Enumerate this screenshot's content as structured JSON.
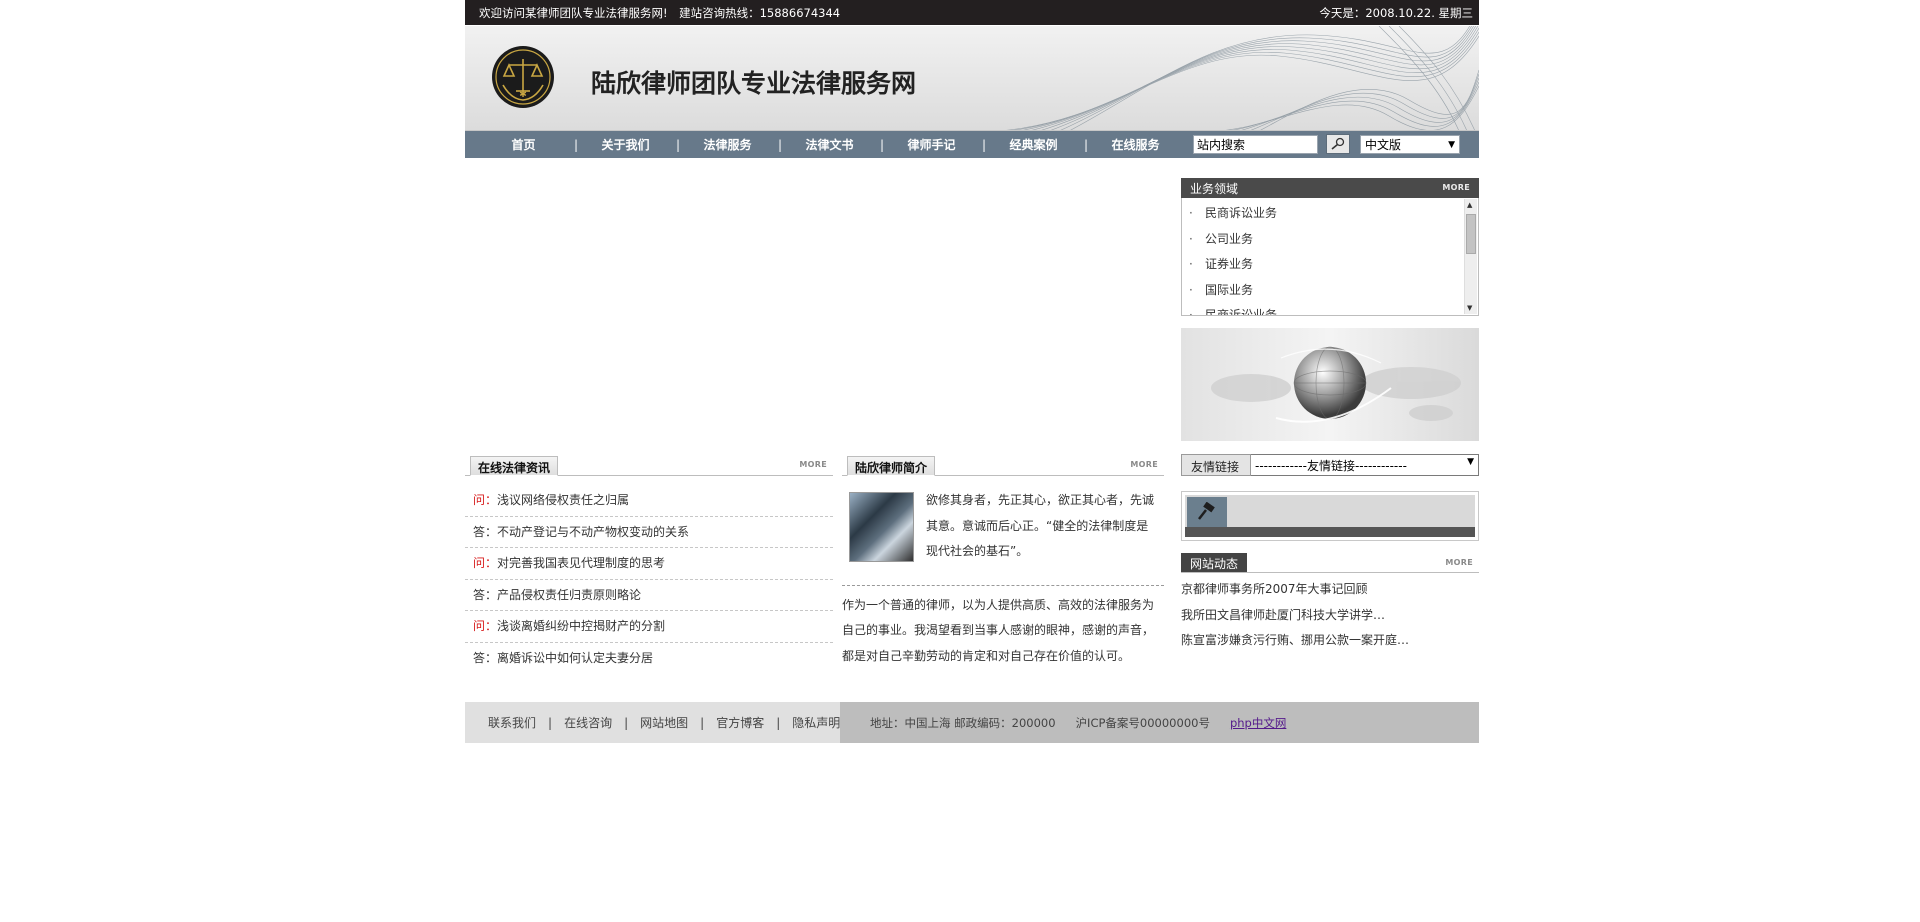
{
  "topbar": {
    "welcome": "欢迎访问某律师团队专业法律服务网!　建站咨询热线：15886674344",
    "date": "今天是：2008.10.22. 星期三"
  },
  "banner": {
    "title": "陆欣律师团队专业法律服务网"
  },
  "nav": {
    "items": [
      "首页",
      "关于我们",
      "法律服务",
      "法律文书",
      "律师手记",
      "经典案例",
      "在线服务"
    ],
    "separator": "|",
    "search_value": "站内搜索",
    "language": "中文版",
    "dropdown_arrow": "▼"
  },
  "more_label": "MORE",
  "news": {
    "title": "在线法律资讯",
    "items": [
      {
        "prefix": "问：",
        "text": "浅议网络侵权责任之归属"
      },
      {
        "prefix": "答：",
        "text": "不动产登记与不动产物权变动的关系"
      },
      {
        "prefix": "问：",
        "text": "对完善我国表见代理制度的思考"
      },
      {
        "prefix": "答：",
        "text": "产品侵权责任归责原则略论"
      },
      {
        "prefix": "问：",
        "text": "浅谈离婚纠纷中控揭财产的分割"
      },
      {
        "prefix": "答：",
        "text": "离婚诉讼中如何认定夫妻分居"
      }
    ]
  },
  "intro": {
    "title": "陆欣律师简介",
    "short": "欲修其身者，先正其心，欲正其心者，先诚其意。意诚而后心正。“健全的法律制度是 现代社会的基石”。",
    "long": "作为一个普通的律师，以为人提供高质、高效的法律服务为自己的事业。我渴望看到当事人感谢的眼神，感谢的声音，都是对自己辛勤劳动的肯定和对自己存在价值的认可。"
  },
  "business": {
    "title": "业务领域",
    "bullet": "·",
    "items": [
      "民商诉讼业务",
      "公司业务",
      "证券业务",
      "国际业务",
      "民商诉讼业务"
    ]
  },
  "friends": {
    "label": "友情链接",
    "select_value": "------------友情链接------------"
  },
  "site_news": {
    "title": "网站动态",
    "items": [
      "京都律师事务所2007年大事记回顾",
      "我所田文昌律师赴厦门科技大学讲学…",
      "陈宣富涉嫌贪污行贿、挪用公款一案开庭…"
    ]
  },
  "footer": {
    "links": [
      "联系我们",
      "在线咨询",
      "网站地图",
      "官方博客",
      "隐私声明"
    ],
    "separator": "|",
    "address": "地址：中国上海 邮政编码：200000",
    "icp": "沪ICP备案号00000000号",
    "php_link": "php中文网"
  },
  "colors": {
    "topbar": "#231f20",
    "nav": "#67798a",
    "question": "#d71a1a",
    "footer_left": "#e0e0e0",
    "footer_right": "#bdbdbd"
  }
}
